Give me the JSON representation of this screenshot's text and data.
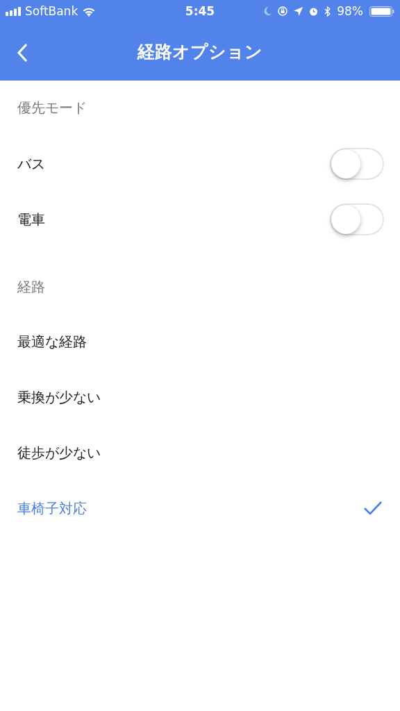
{
  "status_bar": {
    "carrier": "SoftBank",
    "time": "5:45",
    "battery": "98%"
  },
  "header": {
    "title": "経路オプション"
  },
  "sections": [
    {
      "title": "優先モード",
      "items": [
        {
          "kind": "toggle",
          "label": "バス",
          "on": false
        },
        {
          "kind": "toggle",
          "label": "電車",
          "on": false
        }
      ]
    },
    {
      "title": "経路",
      "items": [
        {
          "kind": "option",
          "label": "最適な経路",
          "selected": false
        },
        {
          "kind": "option",
          "label": "乗換が少ない",
          "selected": false
        },
        {
          "kind": "option",
          "label": "徒歩が少ない",
          "selected": false
        },
        {
          "kind": "option",
          "label": "車椅子対応",
          "selected": true
        }
      ]
    }
  ]
}
